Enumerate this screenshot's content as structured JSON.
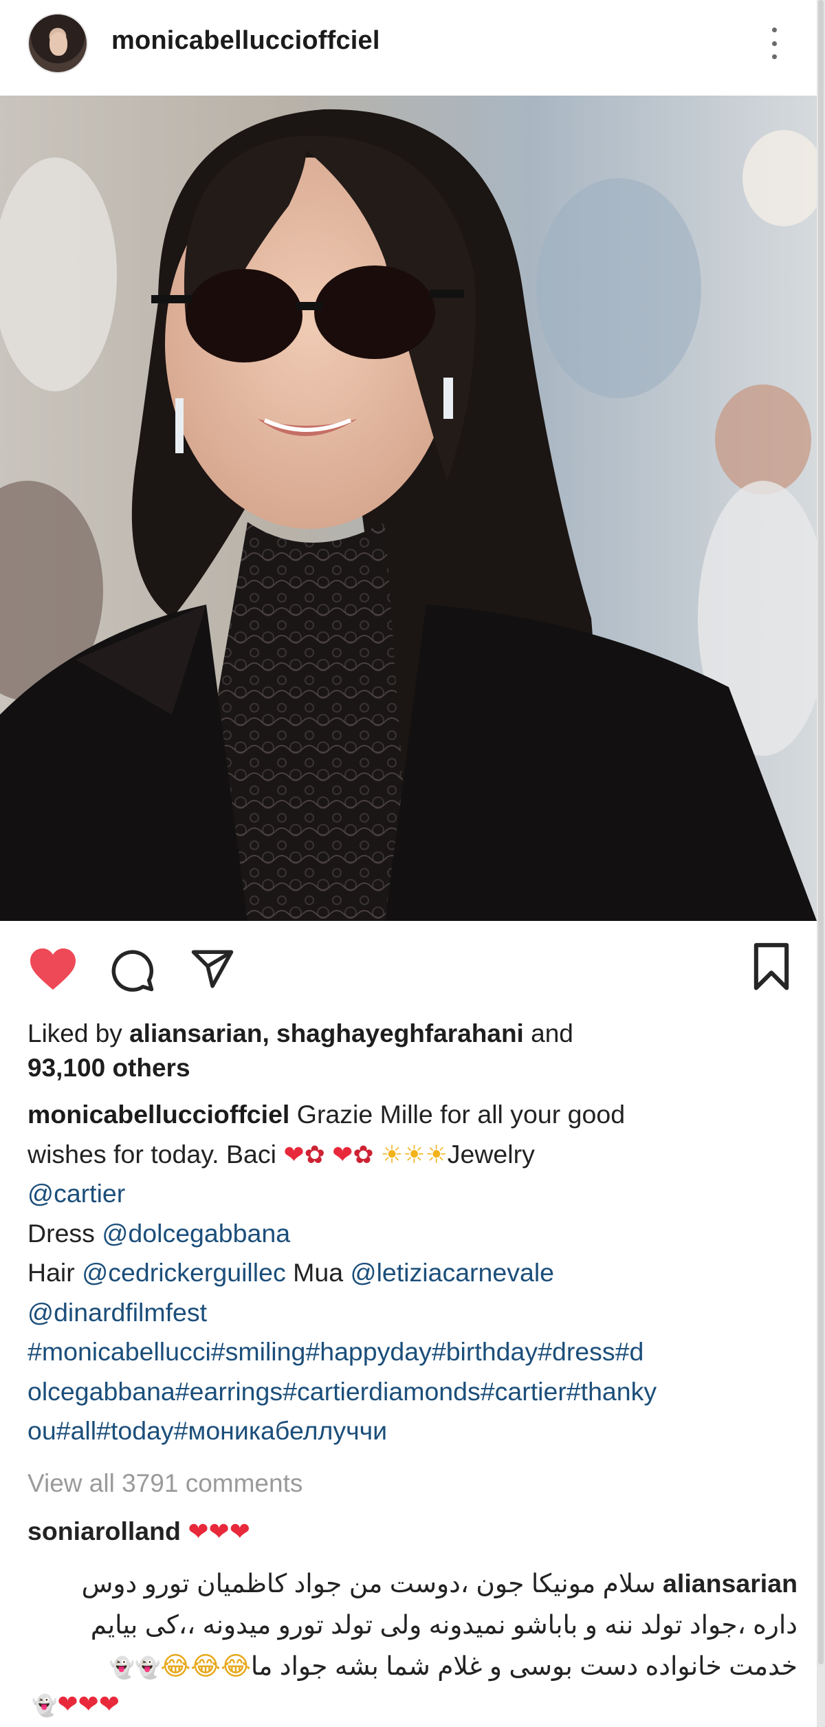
{
  "post": {
    "username": "monicabelluccioffciel",
    "username_display": "monicabelluccioffciel"
  },
  "likes": {
    "prefix": "Liked by ",
    "user1": "aliansarian",
    "separator": ", ",
    "user2": "shaghayeghfarahani",
    "and": " and",
    "others": "93,100 others"
  },
  "caption": {
    "username": "monicabelluccioffciel",
    "text1": " Grazie Mille for all your good",
    "text2": "wishes for today. Baci ",
    "jewelry": "Jewelry",
    "mention_cartier": "@cartier",
    "dress_label": "Dress ",
    "mention_dolce": "@dolcegabbana",
    "hair_label": "Hair ",
    "mention_cedric": "@cedrickerguillec",
    "mua_label": " Mua ",
    "mention_letizia": "@letiziacarnevale",
    "mention_dinard": "@dinardfilmfest",
    "hashtags_line1": "#monicabellucci#smiling#happyday#birthday#dress#d",
    "hashtags_line2": "olcegabbana#earrings#cartierdiamonds#cartier#thanky",
    "hashtags_line3": "ou#all#today#моникабеллуччи"
  },
  "view_all_comments": "View all 3791 comments",
  "comments": [
    {
      "username": "soniarolland",
      "text": ""
    },
    {
      "username": "aliansarian",
      "line1": "سلام مونیکا جون ،دوست من جواد کاظمیان تورو دوس",
      "line2": "داره ،جواد تولد ننه و باباشو نمیدونه ولی تولد تورو میدونه ،،کی بیایم",
      "line3": "خدمت خانواده دست بوسی و غلام شما بشه جواد ما"
    }
  ],
  "icons": {
    "like": "heart-icon",
    "comment": "comment-icon",
    "share": "send-icon",
    "save": "bookmark-icon",
    "more": "more-vertical-icon"
  },
  "colors": {
    "heart": "#ed4956",
    "link": "#1b4e7a",
    "muted": "#9a9a9a"
  }
}
